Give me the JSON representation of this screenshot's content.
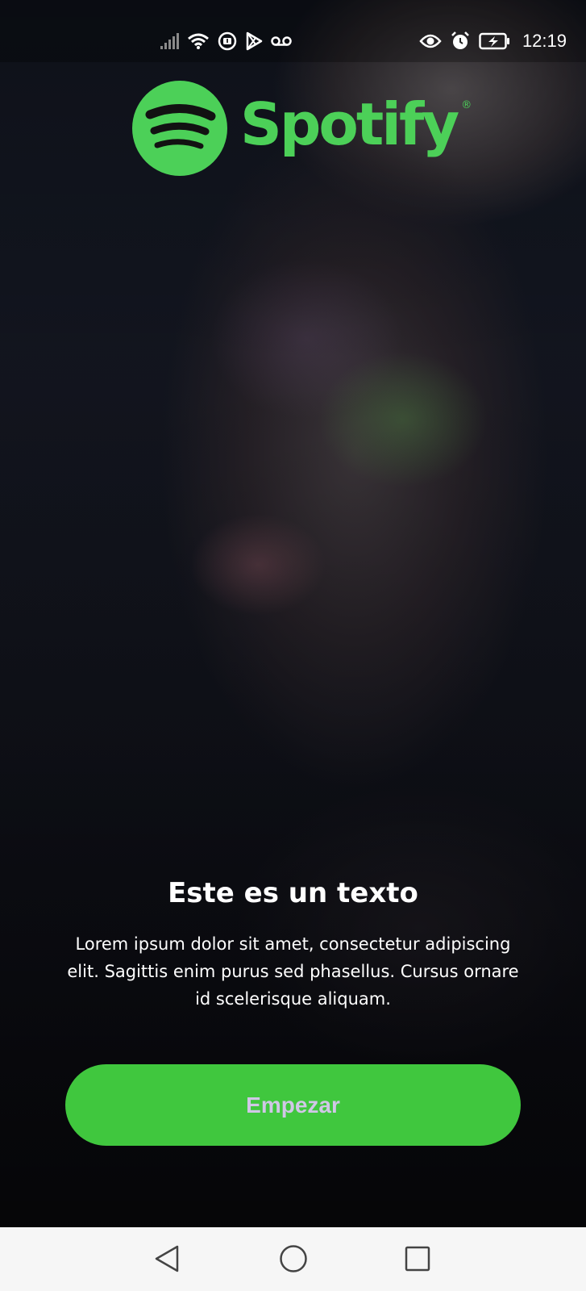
{
  "status_bar": {
    "time": "12:19",
    "left_icons": [
      "signal-icon",
      "wifi-icon",
      "download-icon",
      "play-store-icon",
      "voicemail-icon"
    ],
    "right_icons": [
      "eye-icon",
      "alarm-icon",
      "battery-icon"
    ]
  },
  "brand": {
    "name": "Spotify",
    "registered": "®",
    "color": "#4cd058"
  },
  "onboarding": {
    "headline": "Este es un texto",
    "body": "Lorem ipsum dolor sit amet, consectetur adipiscing elit. Sagittis enim purus sed phasellus. Cursus ornare id scelerisque aliquam.",
    "cta_label": "Empezar",
    "cta_color": "#40c73e"
  },
  "nav_bar": {
    "buttons": [
      "back-icon",
      "home-icon",
      "recents-icon"
    ]
  }
}
